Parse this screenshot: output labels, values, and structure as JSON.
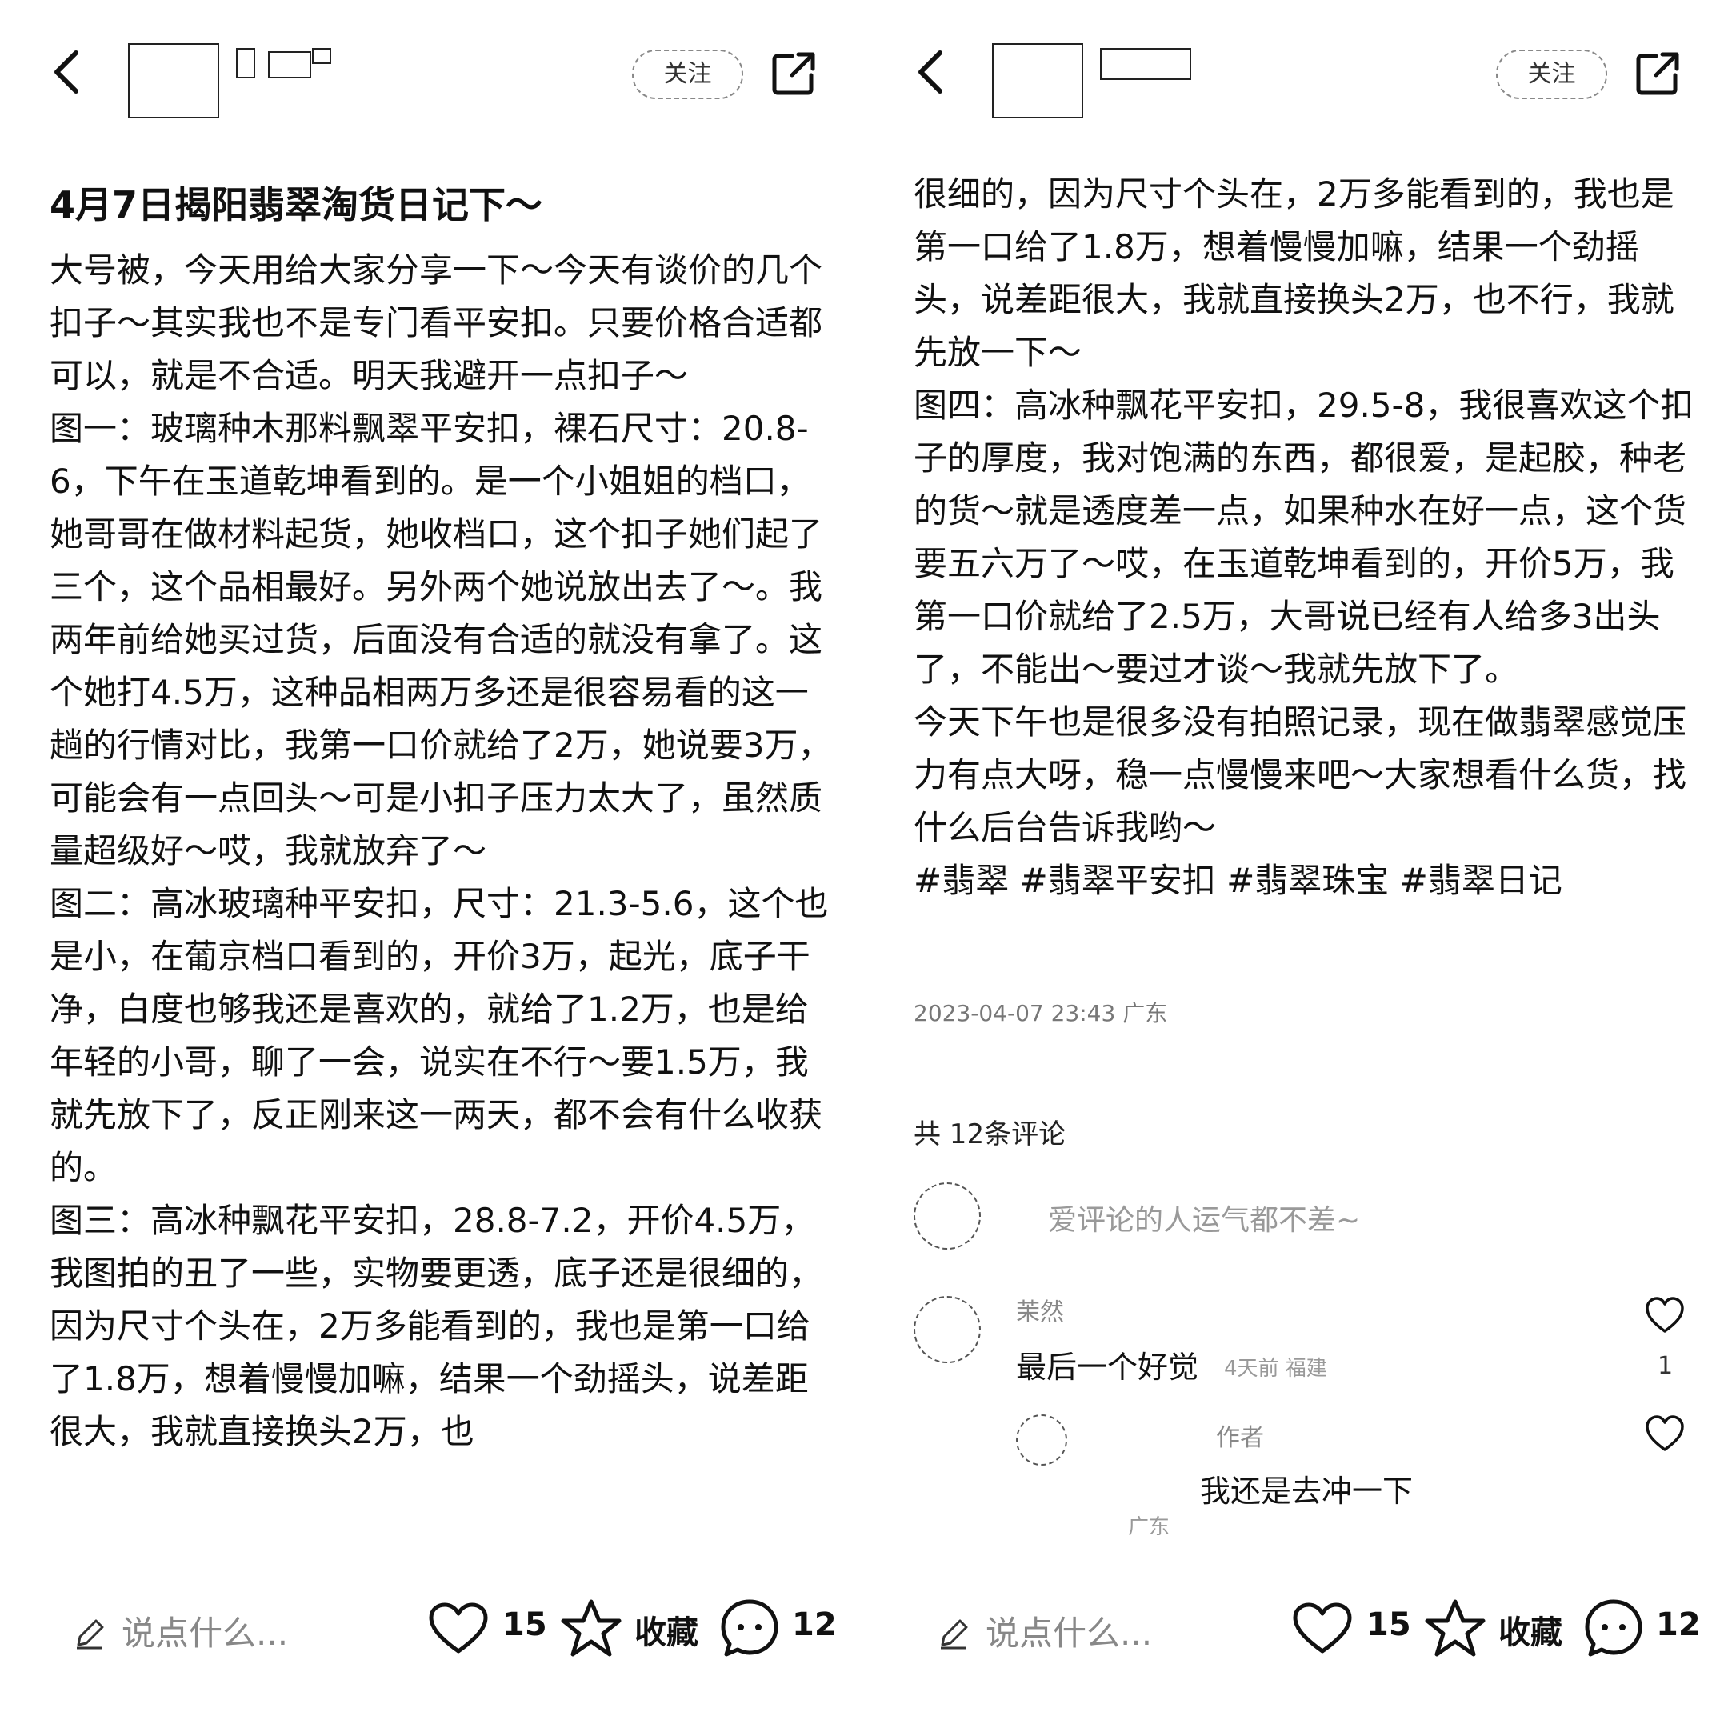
{
  "header": {
    "follow_label": "关注"
  },
  "post": {
    "title": "4月7日揭阳翡翠淘货日记下～",
    "p1": "大号被，今天用给大家分享一下～今天有谈价的几个扣子～其实我也不是专门看平安扣。只要价格合适都可以，就是不合适。明天我避开一点扣子～",
    "p2": "图一：玻璃种木那料飘翠平安扣，裸石尺寸：20.8-6，下午在玉道乾坤看到的。是一个小姐姐的档口，她哥哥在做材料起货，她收档口，这个扣子她们起了三个，这个品相最好。另外两个她说放出去了～。我两年前给她买过货，后面没有合适的就没有拿了。这个她打4.5万，这种品相两万多还是很容易看的这一趟的行情对比，我第一口价就给了2万，她说要3万，可能会有一点回头～可是小扣子压力太大了，虽然质量超级好～哎，我就放弃了～",
    "p3": "图二：高冰玻璃种平安扣，尺寸：21.3-5.6，这个也是小，在葡京档口看到的，开价3万，起光，底子干净，白度也够我还是喜欢的，就给了1.2万，也是给年轻的小哥，聊了一会，说实在不行～要1.5万，我就先放下了，反正刚来这一两天，都不会有什么收获的。",
    "p4": "图三：高冰种飘花平安扣，28.8-7.2，开价4.5万，我图拍的丑了一些，实物要更透，底子还是很细的，因为尺寸个头在，2万多能看到的，我也是第一口给了1.8万，想着慢慢加嘛，结果一个劲摇头，说差距很大，我就直接换头2万，也",
    "r_partial": "很细的，因为尺寸个头在，2万多能看到的，我也是第一口给了1.8万，想着慢慢加嘛，结果一个劲摇头，说差距很大，我就直接换头2万，也不行，我就先放一下～",
    "r_p5": "图四：高冰种飘花平安扣，29.5-8，我很喜欢这个扣子的厚度，我对饱满的东西，都很爱，是起胶，种老的货～就是透度差一点，如果种水在好一点，这个货要五六万了～哎，在玉道乾坤看到的，开价5万，我第一口价就给了2.5万，大哥说已经有人给多3出头了，不能出～要过才谈～我就先放下了。",
    "r_p6": "今天下午也是很多没有拍照记录，现在做翡翠感觉压力有点大呀，稳一点慢慢来吧～大家想看什么货，找什么后台告诉我哟～",
    "r_tags": "#翡翠 #翡翠平安扣 #翡翠珠宝 #翡翠日记",
    "meta": "2023-04-07 23:43 广东"
  },
  "comments": {
    "header": "共 12条评论",
    "input_placeholder": "爱评论的人运气都不差~",
    "items": [
      {
        "name": "茉然",
        "text": "最后一个好觉",
        "time": "4天前 福建",
        "likes": "1"
      },
      {
        "name": "",
        "tag": "作者",
        "text": "我还是去冲一下",
        "time": "广东",
        "likes": ""
      }
    ]
  },
  "bottombar": {
    "input_placeholder": "说点什么...",
    "like_count": "15",
    "collect_label": "收藏",
    "comment_count": "12"
  }
}
